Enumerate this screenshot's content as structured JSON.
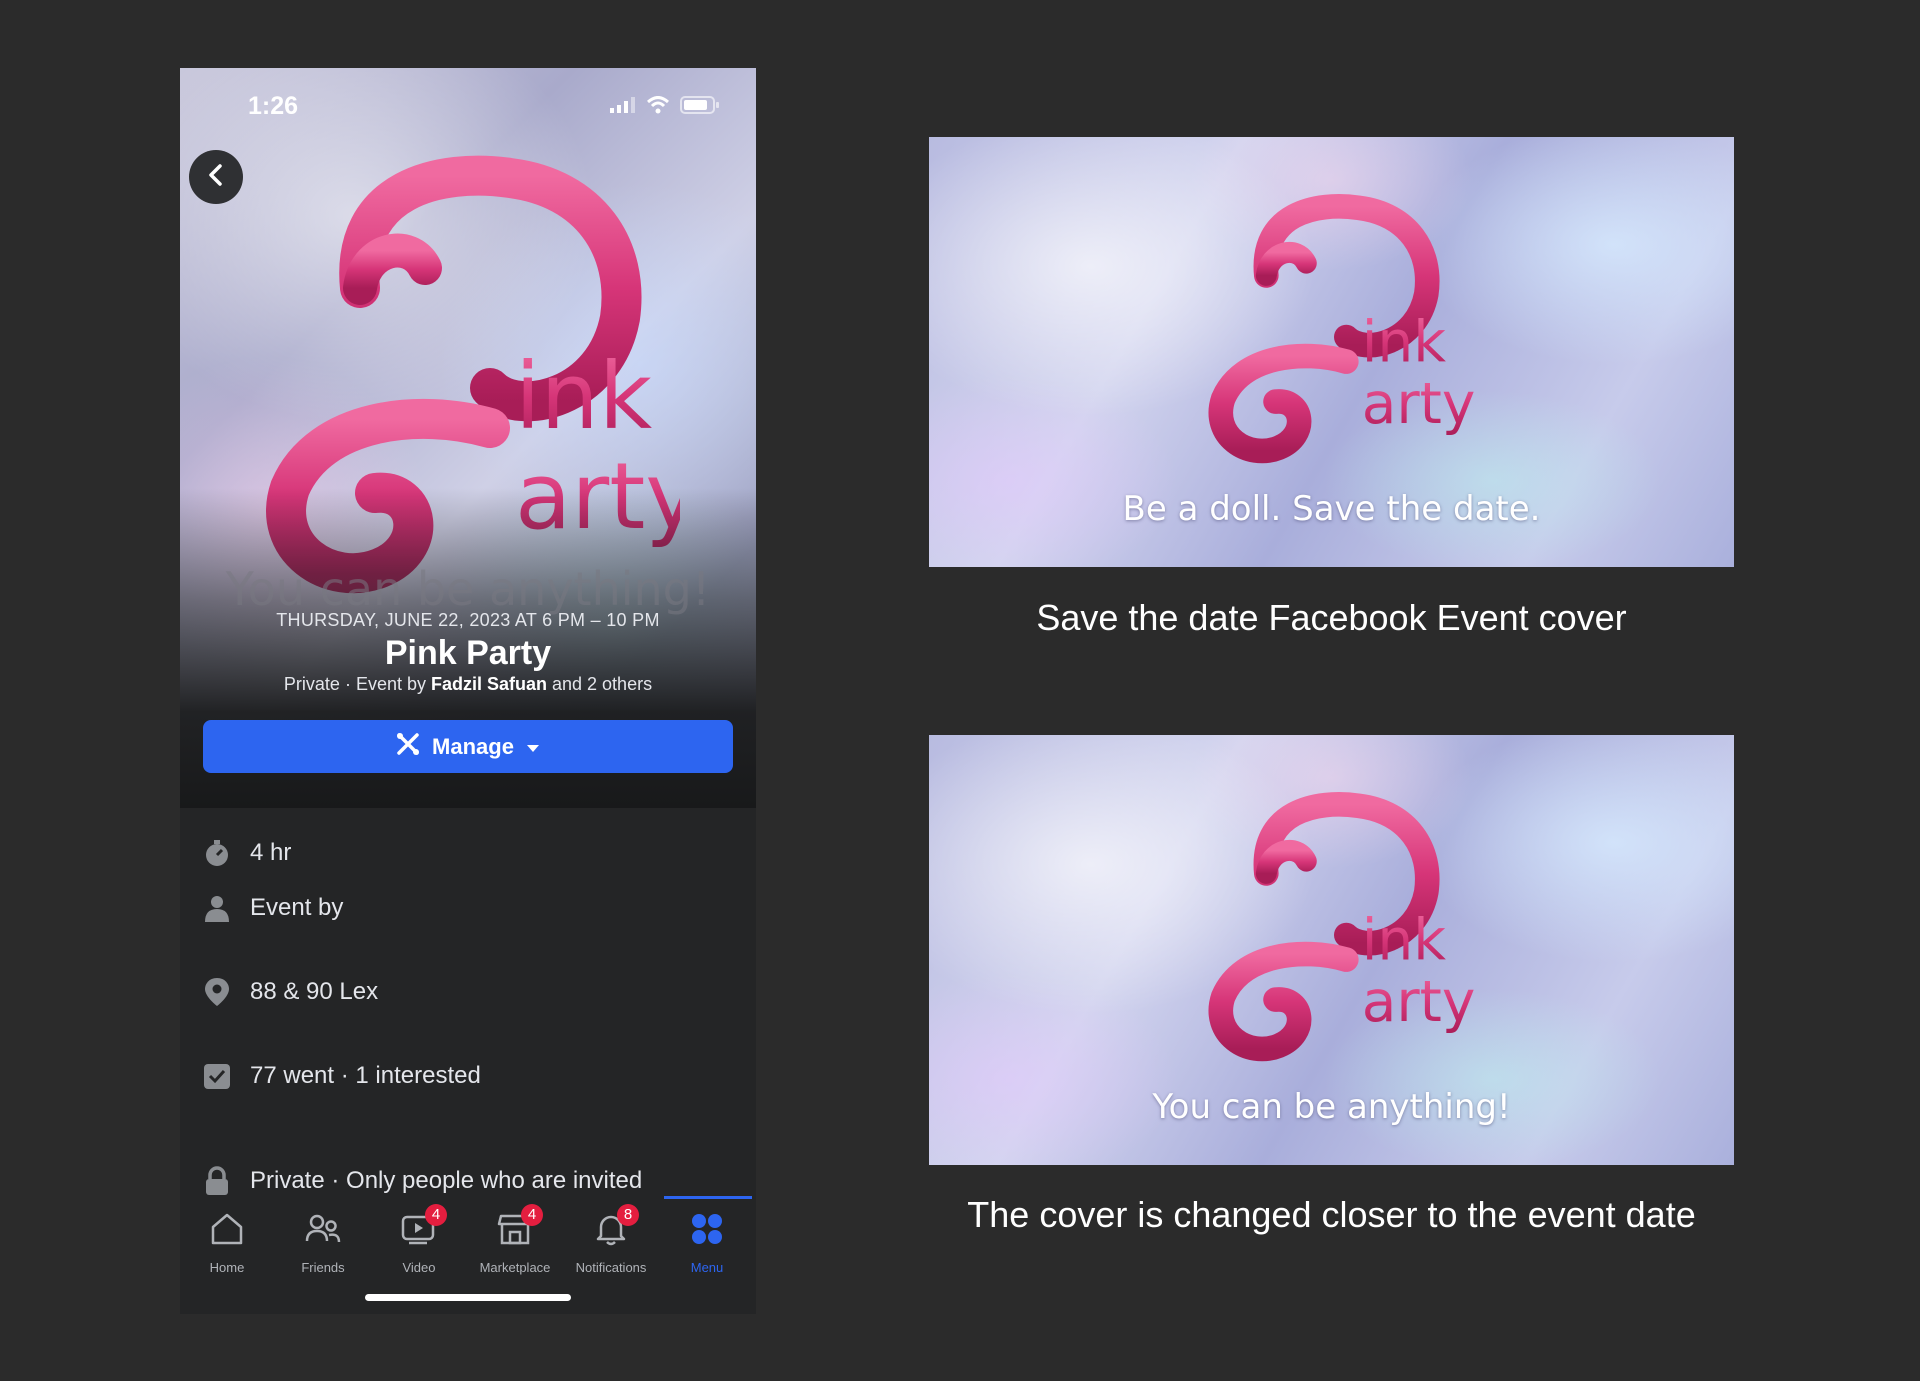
{
  "phone": {
    "status": {
      "time": "1:26"
    },
    "cover": {
      "tagline": "You can be anything!",
      "logo_text": "Pink Party"
    },
    "event": {
      "date": "THURSDAY, JUNE 22, 2023 AT 6 PM – 10 PM",
      "title": "Pink Party",
      "sub_prefix": "Private · Event by ",
      "host": "Fadzil Safuan",
      "sub_suffix": " and 2 others"
    },
    "manage_label": "Manage",
    "details": [
      {
        "icon": "stopwatch-icon",
        "text": "4 hr"
      },
      {
        "icon": "person-icon",
        "text": "Event by"
      },
      {
        "icon": "location-pin-icon",
        "text": "88 & 90 Lex"
      },
      {
        "icon": "checkbox-icon",
        "text": "77 went · 1 interested"
      },
      {
        "icon": "lock-icon",
        "text": "Private · Only people who are invited"
      }
    ],
    "tabs": [
      {
        "label": "Home",
        "icon": "home-icon",
        "badge": ""
      },
      {
        "label": "Friends",
        "icon": "friends-icon",
        "badge": ""
      },
      {
        "label": "Video",
        "icon": "video-icon",
        "badge": "4"
      },
      {
        "label": "Marketplace",
        "icon": "marketplace-icon",
        "badge": "4"
      },
      {
        "label": "Notifications",
        "icon": "bell-icon",
        "badge": "8"
      },
      {
        "label": "Menu",
        "icon": "menu-grid-icon",
        "badge": ""
      }
    ],
    "active_tab": "Menu"
  },
  "covers": [
    {
      "tagline": "Be a doll. Save the date.",
      "caption": "Save the date Facebook Event cover"
    },
    {
      "tagline": "You can be anything!",
      "caption": "The cover is changed closer to the event date"
    }
  ],
  "colors": {
    "accent": "#2d65f0",
    "pink": "#e0457e",
    "badge": "#e41e3f"
  }
}
